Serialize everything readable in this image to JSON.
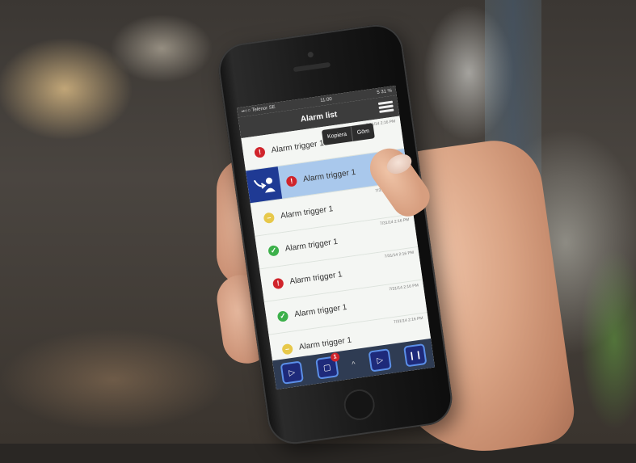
{
  "status_bar": {
    "carrier": "••○○ Telenor SE",
    "time": "11:00",
    "battery": "5 31 %"
  },
  "nav": {
    "title": "Alarm list",
    "menu_icon": "hamburger-menu-icon"
  },
  "context_menu": {
    "copy": "Kopiera",
    "hide": "Göm"
  },
  "alarms": [
    {
      "label": "Alarm trigger 1",
      "time": "7/31/14 2:16 PM",
      "status": "red"
    },
    {
      "label": "Alarm trigger 1",
      "time": "",
      "status": "red",
      "selected": true
    },
    {
      "label": "Alarm trigger 1",
      "time": "7/31/14 2:16 PM",
      "status": "yellow"
    },
    {
      "label": "Alarm trigger 1",
      "time": "7/31/14 2:16 PM",
      "status": "green"
    },
    {
      "label": "Alarm trigger 1",
      "time": "7/31/14 2:16 PM",
      "status": "red"
    },
    {
      "label": "Alarm trigger 1",
      "time": "7/31/14 2:16 PM",
      "status": "green"
    },
    {
      "label": "Alarm trigger 1",
      "time": "7/31/14 2:16 PM",
      "status": "yellow"
    }
  ],
  "toolbar": {
    "badge_count": "1"
  },
  "colors": {
    "red": "#d0242b",
    "green": "#3cb04a",
    "yellow": "#e7c84a",
    "selected": "#a9c8ec",
    "ack": "#1f3a94"
  }
}
